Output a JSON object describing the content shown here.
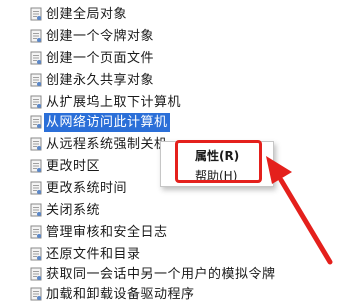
{
  "list": {
    "items": [
      {
        "label": "创建全局对象",
        "selected": false
      },
      {
        "label": "创建一个令牌对象",
        "selected": false
      },
      {
        "label": "创建一个页面文件",
        "selected": false
      },
      {
        "label": "创建永久共享对象",
        "selected": false
      },
      {
        "label": "从扩展坞上取下计算机",
        "selected": false
      },
      {
        "label": "从网络访问此计算机",
        "selected": true
      },
      {
        "label": "从远程系统强制关机",
        "selected": false
      },
      {
        "label": "更改时区",
        "selected": false
      },
      {
        "label": "更改系统时间",
        "selected": false
      },
      {
        "label": "关闭系统",
        "selected": false
      },
      {
        "label": "管理审核和安全日志",
        "selected": false
      },
      {
        "label": "还原文件和目录",
        "selected": false
      },
      {
        "label": "获取同一会话中另一个用户的模拟令牌",
        "selected": false
      },
      {
        "label": "加载和卸载设备驱动程序",
        "selected": false
      }
    ],
    "item_icon": "policy-document-icon"
  },
  "context_menu": {
    "properties_label": "属性(R)",
    "help_label": "帮助(H)"
  },
  "annotation": {
    "highlight_color": "#e4201c",
    "arrow_icon": "red-arrow-icon"
  },
  "colors": {
    "selection": "#2b6fd8",
    "annotation_red": "#e4201c"
  }
}
